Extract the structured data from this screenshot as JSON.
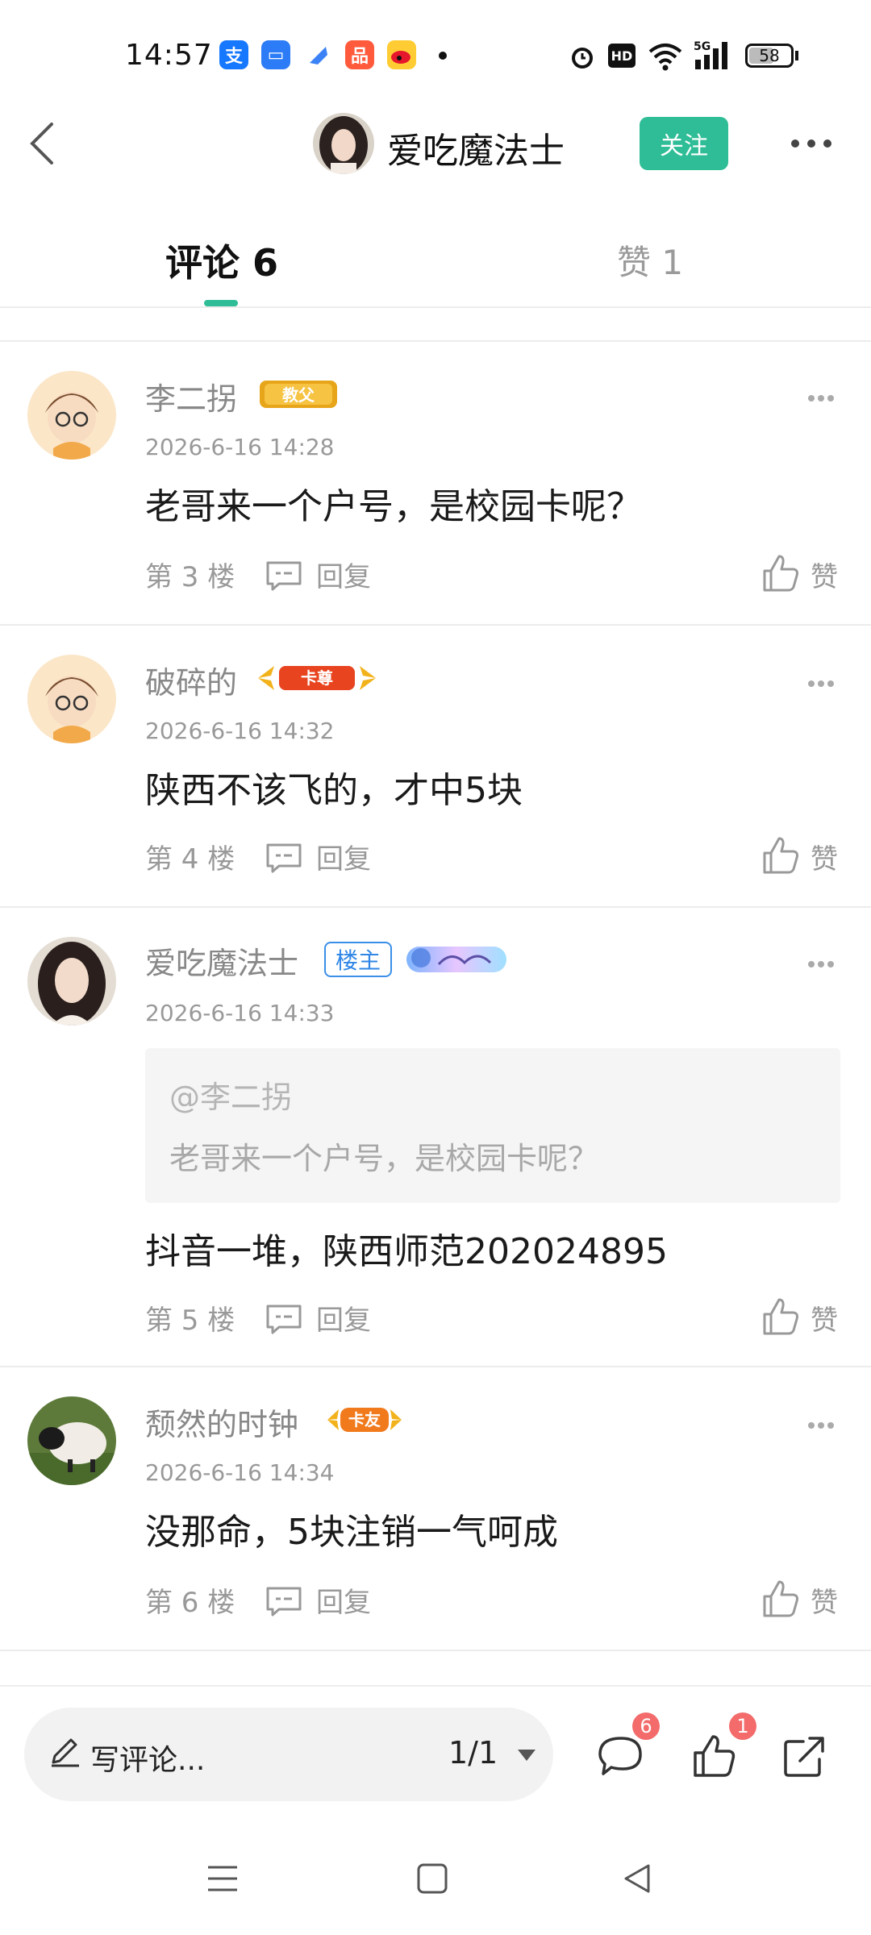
{
  "status_bar": {
    "time": "14:57",
    "battery": "58",
    "network": "5G"
  },
  "header": {
    "title": "爱吃魔法士",
    "follow_label": "关注"
  },
  "tabs": [
    {
      "label": "评论 6",
      "active": true
    },
    {
      "label": "赞 1",
      "active": false
    }
  ],
  "comments": [
    {
      "username": "李二拐",
      "badge": "教父",
      "time": "2026-6-16 14:28",
      "text": "老哥来一个户号，是校园卡呢？",
      "floor": "第 3 楼",
      "reply_label": "回复",
      "like_label": "赞"
    },
    {
      "username": "破碎的",
      "badge": "卡尊",
      "time": "2026-6-16 14:32",
      "text": "陕西不该飞的，才中5块",
      "floor": "第 4 楼",
      "reply_label": "回复",
      "like_label": "赞"
    },
    {
      "username": "爱吃魔法士",
      "owner_badge": "楼主",
      "time": "2026-6-16 14:33",
      "quote_user": "@李二拐",
      "quote_text": "老哥来一个户号，是校园卡呢？",
      "text": "抖音一堆，陕西师范202024895",
      "floor": "第 5 楼",
      "reply_label": "回复",
      "like_label": "赞"
    },
    {
      "username": "颓然的时钟",
      "badge": "卡友",
      "time": "2026-6-16 14:34",
      "text": "没那命，5块注销一气呵成",
      "floor": "第 6 楼",
      "reply_label": "回复",
      "like_label": "赞"
    }
  ],
  "bottom_bar": {
    "placeholder": "写评论...",
    "page_indicator": "1/1",
    "comment_count": "6",
    "like_count": "1"
  },
  "colors": {
    "accent": "#2ebd96",
    "badge_red": "#f36b6b",
    "owner_blue": "#2f86e6"
  }
}
